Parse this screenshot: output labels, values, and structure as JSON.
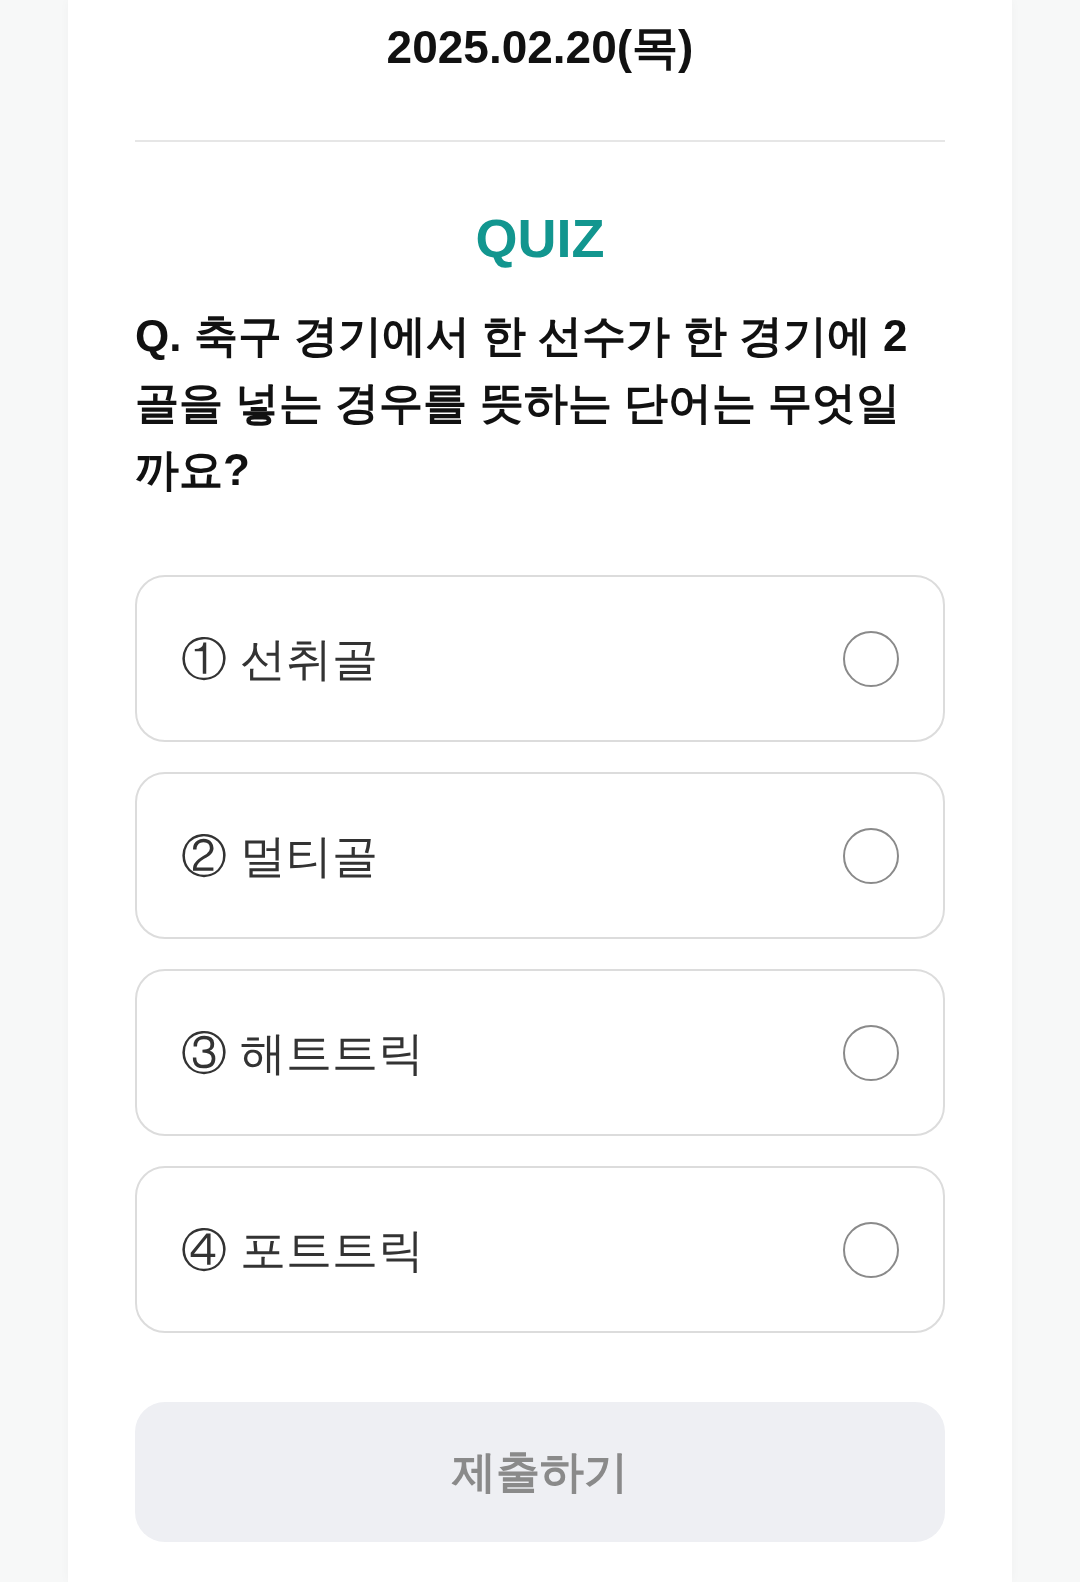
{
  "date": "2025.02.20(목)",
  "quiz": {
    "heading": "QUIZ",
    "question": "Q. 축구 경기에서 한 선수가 한 경기에 2골을 넣는 경우를 뜻하는 단어는 무엇일까요?",
    "options": [
      {
        "label": "① 선취골",
        "selected": false
      },
      {
        "label": "② 멀티골",
        "selected": false
      },
      {
        "label": "③ 해트트릭",
        "selected": false
      },
      {
        "label": "④ 포트트릭",
        "selected": false
      }
    ]
  },
  "submit": {
    "label": "제출하기",
    "disabled": true
  }
}
